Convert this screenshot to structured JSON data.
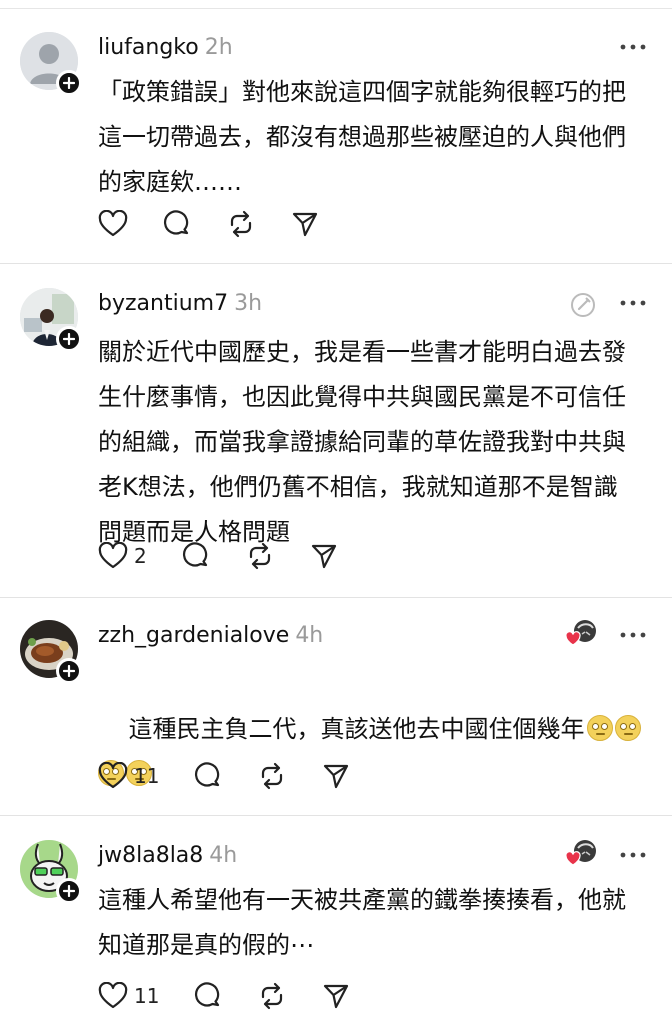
{
  "posts": [
    {
      "username": "liufangko",
      "time": "2h",
      "avatar": "default-avatar",
      "text": "「政策錯誤」對他來說這四個字就能夠很輕巧的把\n這一切帶過去，都沒有想過那些被壓迫的人與他們\n的家庭欸……",
      "likes": "",
      "extra_icon": null
    },
    {
      "username": "byzantium7",
      "time": "3h",
      "avatar": "photo-avatar-person",
      "text": "關於近代中國歷史，我是看一些書才能明白過去發\n生什麼事情，也因此覺得中共與國民黨是不可信任\n的組織，而當我拿證據給同輩的草佐證我對中共與\n老K想法，他們仍舊不相信，我就知道那不是智識\n問題而是人格問題",
      "likes": "2",
      "extra_icon": "edit-circle-icon"
    },
    {
      "username": "zzh_gardenialove",
      "time": "4h",
      "avatar": "photo-avatar-food",
      "text": "這種民主負二代，真該送他去中國住個幾年",
      "likes": "11",
      "extra_icon": "liked-by-author-icon"
    },
    {
      "username": "jw8la8la8",
      "time": "4h",
      "avatar": "cartoon-avatar-green",
      "text": "這種人希望他有一天被共產黨的鐵拳揍揍看，他就\n知道那是真的假的⋯",
      "likes": "11",
      "extra_icon": "liked-by-author-icon"
    }
  ],
  "icons": {
    "like": "heart-outline-icon",
    "reply": "speech-bubble-icon",
    "repost": "repost-arrows-icon",
    "share": "send-paper-plane-icon",
    "more": "more-horizontal-icon",
    "follow": "plus-icon"
  },
  "colors": {
    "text": "#111111",
    "muted": "#9a9a9a",
    "divider": "#e3e3e3",
    "heart_red": "#e8334a"
  }
}
